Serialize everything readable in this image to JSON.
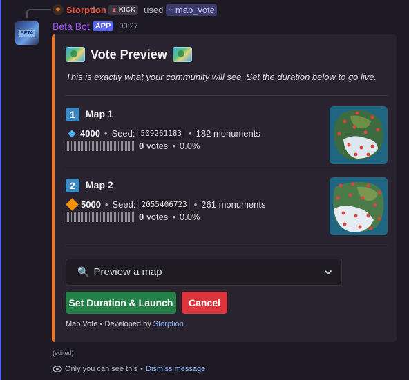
{
  "reply": {
    "user_name": "Storption",
    "user_tag": "KICK",
    "used_text": "used",
    "command": "map_vote",
    "avatar_icon": "flame-gear-icon"
  },
  "message": {
    "bot_name": "Beta Bot",
    "app_tag": "APP",
    "timestamp": "00:27",
    "avatar_badge": "BETA",
    "edited": "(edited)"
  },
  "embed": {
    "accent_color": "#f97316",
    "title": "Vote Preview",
    "description": "This is exactly what your community will see. Set the duration below to go live.",
    "maps": [
      {
        "number": "1",
        "name": "Map 1",
        "size": "4000",
        "size_icon": "small-blue-diamond-icon",
        "seed_label": "Seed:",
        "seed": "509261183",
        "monuments": "182 monuments",
        "votes": "0",
        "votes_label": "votes",
        "percent": "0.0%",
        "vote_fraction": 0
      },
      {
        "number": "2",
        "name": "Map 2",
        "size": "5000",
        "size_icon": "large-orange-diamond-icon",
        "seed_label": "Seed:",
        "seed": "2055406723",
        "monuments": "261 monuments",
        "votes": "0",
        "votes_label": "votes",
        "percent": "0.0%",
        "vote_fraction": 0
      }
    ],
    "select": {
      "placeholder": "Preview a map",
      "icon": "magnifier-icon"
    },
    "buttons": {
      "launch": "Set Duration & Launch",
      "cancel": "Cancel"
    },
    "footer": {
      "text": "Map Vote • Developed by",
      "author": "Storption"
    }
  },
  "ephemeral": {
    "text": "Only you can see this",
    "separator": "•",
    "dismiss": "Dismiss message"
  },
  "colors": {
    "launch_button": "#248046",
    "cancel_button": "#da373c",
    "bot_name": "#a64dff",
    "reply_name": "#e2543a",
    "link": "#8ab4f8"
  }
}
